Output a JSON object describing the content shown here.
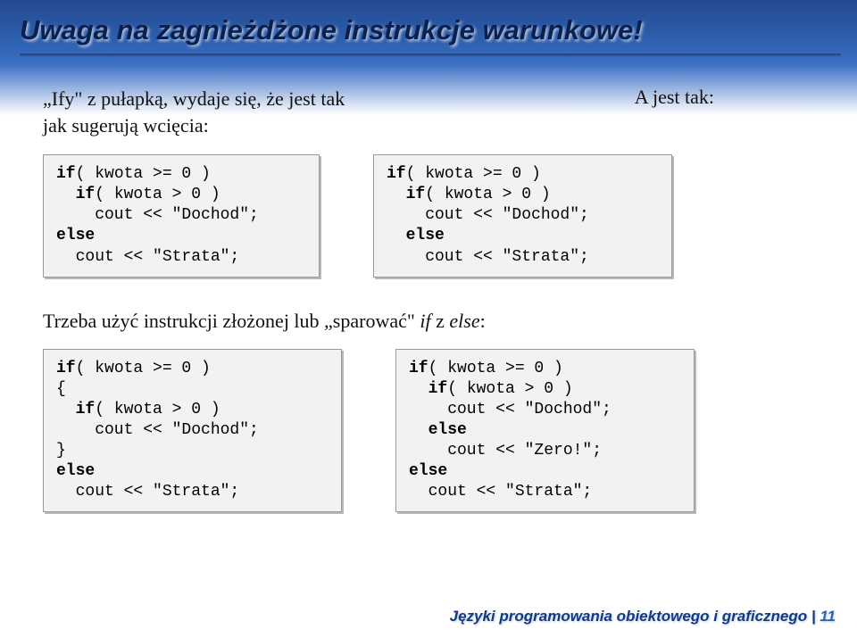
{
  "title": "Uwaga na zagnieżdżone instrukcje warunkowe!",
  "intro": {
    "left_line1": "„Ify\" z pułapką, wydaje się, że jest tak",
    "left_line2": "jak sugerują wcięcia:",
    "right": "A jest tak:"
  },
  "row1": {
    "left": {
      "l1a": "if",
      "l1b": "( kwota >= 0 )",
      "l2a": "  if",
      "l2b": "( kwota > 0 )",
      "l3": "    cout << \"Dochod\";",
      "l4": "else",
      "l5": "  cout << \"Strata\";"
    },
    "right": {
      "l1a": "if",
      "l1b": "( kwota >= 0 )",
      "l2a": "  if",
      "l2b": "( kwota > 0 )",
      "l3": "    cout << \"Dochod\";",
      "l4a": "  else",
      "l5": "    cout << \"Strata\";"
    }
  },
  "mid": {
    "t1": "Trzeba użyć instrukcji złożonej lub „sparować\" ",
    "t2": "if",
    "t3": " z ",
    "t4": "else",
    "t5": ":"
  },
  "row2": {
    "left": {
      "l1a": "if",
      "l1b": "( kwota >= 0 )",
      "l2": "{",
      "l3a": "  if",
      "l3b": "( kwota > 0 )",
      "l4": "    cout << \"Dochod\";",
      "l5": "}",
      "l6": "else",
      "l7": "  cout << \"Strata\";"
    },
    "right": {
      "l1a": "if",
      "l1b": "( kwota >= 0 )",
      "l2a": "  if",
      "l2b": "( kwota > 0 )",
      "l3": "    cout << \"Dochod\";",
      "l4a": "  else",
      "l5": "    cout << \"Zero!\";",
      "l6": "else",
      "l7": "  cout << \"Strata\";"
    }
  },
  "footer": {
    "text": "Języki programowania obiektowego i graficznego",
    "sep": " | ",
    "page": "11"
  }
}
